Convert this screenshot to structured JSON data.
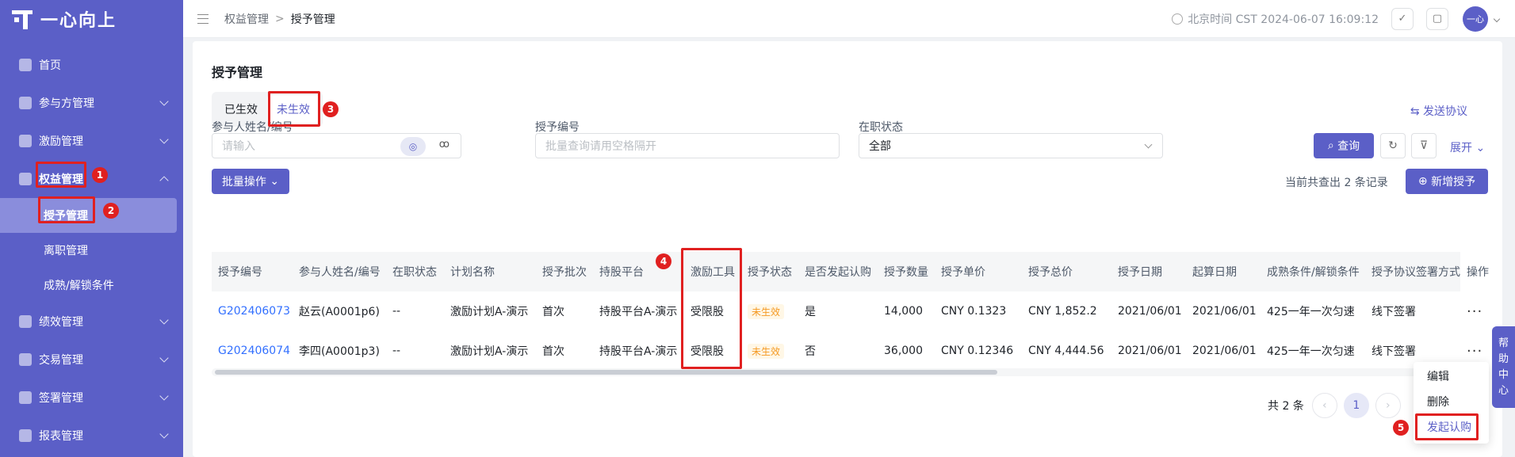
{
  "app": {
    "logo_text": "一心向上"
  },
  "sidebar": {
    "items": [
      {
        "label": "首页"
      },
      {
        "label": "参与方管理"
      },
      {
        "label": "激励管理"
      },
      {
        "label": "权益管理"
      },
      {
        "label": "绩效管理"
      },
      {
        "label": "交易管理"
      },
      {
        "label": "签署管理"
      },
      {
        "label": "报表管理"
      }
    ],
    "subitems": [
      {
        "label": "授予管理"
      },
      {
        "label": "离职管理"
      },
      {
        "label": "成熟/解锁条件"
      }
    ]
  },
  "header": {
    "breadcrumb": [
      "权益管理",
      "授予管理"
    ],
    "time": "北京时间 CST 2024-06-07 16:09:12",
    "avatar": "一心"
  },
  "page": {
    "title": "授予管理",
    "tabs": [
      {
        "label": "已生效"
      },
      {
        "label": "未生效"
      }
    ],
    "send_protocol": "发送协议",
    "filters": {
      "participant_label": "参与人姓名/编号",
      "participant_placeholder": "请输入",
      "grant_no_label": "授予编号",
      "grant_no_placeholder": "批量查询请用空格隔开",
      "status_label": "在职状态",
      "status_value": "全部"
    },
    "query_btn": "查询",
    "expand": "展开",
    "batch_btn": "批量操作",
    "record_text": "当前共查出 2 条记录",
    "new_btn": "新增授予"
  },
  "table": {
    "headers": [
      "授予编号",
      "参与人姓名/编号",
      "在职状态",
      "计划名称",
      "授予批次",
      "持股平台",
      "激励工具",
      "授予状态",
      "是否发起认购",
      "授予数量",
      "授予单价",
      "授予总价",
      "授予日期",
      "起算日期",
      "成熟条件/解锁条件",
      "授予协议签署方式",
      "操作"
    ],
    "rows": [
      [
        "G202406073",
        "赵云(A0001p6)",
        "--",
        "激励计划A-演示",
        "首次",
        "持股平台A-演示",
        "受限股",
        "未生效",
        "是",
        "14,000",
        "CNY  0.1323",
        "CNY  1,852.2",
        "2021/06/01",
        "2021/06/01",
        "425一年一次匀速",
        "线下签署",
        "···"
      ],
      [
        "G202406074",
        "李四(A0001p3)",
        "--",
        "激励计划A-演示",
        "首次",
        "持股平台A-演示",
        "受限股",
        "未生效",
        "否",
        "36,000",
        "CNY  0.12346",
        "CNY  4,444.56",
        "2021/06/01",
        "2021/06/01",
        "425一年一次匀速",
        "线下签署",
        "···"
      ]
    ]
  },
  "pagination": {
    "total": "共 2 条",
    "current": "1",
    "prev": "‹",
    "next": "›"
  },
  "dropdown": {
    "items": [
      "编辑",
      "删除",
      "发起认购"
    ]
  },
  "help": {
    "chars": [
      "帮",
      "助",
      "中",
      "心"
    ]
  },
  "annotations": [
    "1",
    "2",
    "3",
    "4",
    "5"
  ]
}
